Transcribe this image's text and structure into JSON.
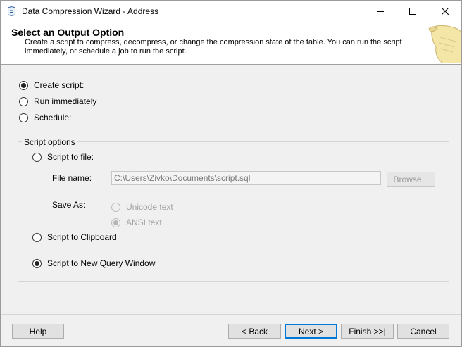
{
  "window": {
    "title": "Data Compression Wizard - Address",
    "minimize_label": "—",
    "maximize_label": "☐",
    "close_label": "✕"
  },
  "header": {
    "title": "Select an Output Option",
    "description": "Create a script to compress, decompress, or change the compression state of the table. You can run the script immediately, or schedule a job to run the script."
  },
  "output_options": [
    {
      "label": "Create script:",
      "selected": true
    },
    {
      "label": "Run immediately",
      "selected": false
    },
    {
      "label": "Schedule:",
      "selected": false
    }
  ],
  "script_options": {
    "group_label": "Script options",
    "script_to_file": {
      "label": "Script to file:",
      "selected": false
    },
    "file_name_label": "File name:",
    "file_name_value": "C:\\Users\\Zivko\\Documents\\script.sql",
    "browse_label": "Browse...",
    "save_as_label": "Save As:",
    "unicode_label": "Unicode text",
    "ansi_label": "ANSI text",
    "ansi_selected": true,
    "script_to_clipboard": {
      "label": "Script to Clipboard",
      "selected": false
    },
    "script_to_query_window": {
      "label": "Script to New Query Window",
      "selected": true
    }
  },
  "footer": {
    "help": "Help",
    "back": "< Back",
    "next": "Next >",
    "finish": "Finish >>|",
    "cancel": "Cancel"
  }
}
